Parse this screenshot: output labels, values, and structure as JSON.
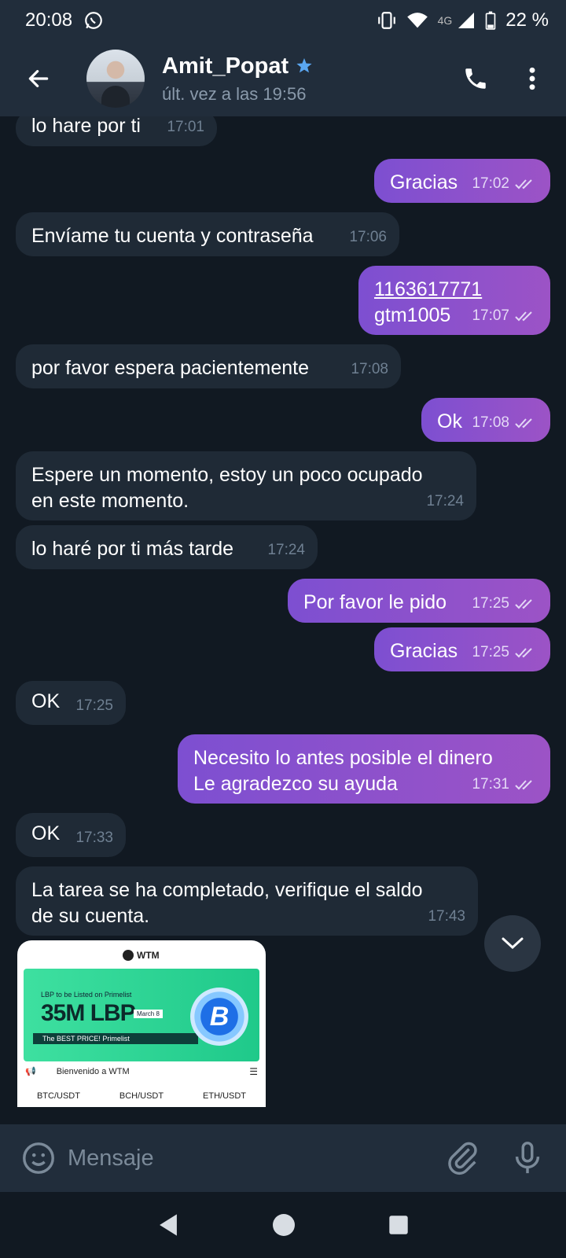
{
  "status_bar": {
    "time": "20:08",
    "network": "4G",
    "battery": "22 %"
  },
  "header": {
    "contact_name": "Amit_Popat",
    "last_seen": "últ. vez a las 19:56"
  },
  "messages": [
    {
      "dir": "in",
      "text": "lo hare por ti",
      "time": "17:01"
    },
    {
      "dir": "out",
      "text": "Gracias",
      "time": "17:02"
    },
    {
      "dir": "in",
      "text": "Envíame tu cuenta y contraseña",
      "time": "17:06"
    },
    {
      "dir": "out",
      "line1": "1163617771",
      "line2": "gtm1005",
      "time": "17:07"
    },
    {
      "dir": "in",
      "text": "por favor espera pacientemente",
      "time": "17:08"
    },
    {
      "dir": "out",
      "text": "Ok",
      "time": "17:08"
    },
    {
      "dir": "in",
      "line1": "Espere un momento, estoy un poco ocupado",
      "line2": "en este momento.",
      "time": "17:24"
    },
    {
      "dir": "in",
      "text": "lo haré por ti más tarde",
      "time": "17:24"
    },
    {
      "dir": "out",
      "text": "Por favor le pido",
      "time": "17:25"
    },
    {
      "dir": "out",
      "text": "Gracias",
      "time": "17:25"
    },
    {
      "dir": "in",
      "text": "OK",
      "time": "17:25"
    },
    {
      "dir": "out",
      "line1": "Necesito lo antes posible el dinero",
      "line2": "Le agradezco su ayuda",
      "time": "17:31"
    },
    {
      "dir": "in",
      "text": "OK",
      "time": "17:33"
    },
    {
      "dir": "in",
      "line1": "La tarea se ha completado, verifique el saldo",
      "line2": "de su cuenta.",
      "time": "17:43"
    }
  ],
  "image_message": {
    "brand": "WTM",
    "banner_caption": "LBP to be Listed on Primelist",
    "banner_amount": "35M LBP",
    "banner_date": "March 8",
    "banner_tagline": "The BEST PRICE!  Primelist",
    "coin_letter": "B",
    "welcome": "Bienvenido a WTM",
    "pairs": [
      "BTC/USDT",
      "BCH/USDT",
      "ETH/USDT"
    ]
  },
  "composer": {
    "placeholder": "Mensaje"
  },
  "colors": {
    "outgoing": "#8a52cc",
    "incoming": "#1f2a36",
    "header": "#212d3b",
    "background": "#111922"
  },
  "icons": [
    "back-arrow-icon",
    "verified-star-icon",
    "phone-icon",
    "more-vert-icon",
    "emoji-icon",
    "attach-icon",
    "mic-icon",
    "chevron-down-icon",
    "nav-back-icon",
    "nav-home-icon",
    "nav-recents-icon"
  ]
}
